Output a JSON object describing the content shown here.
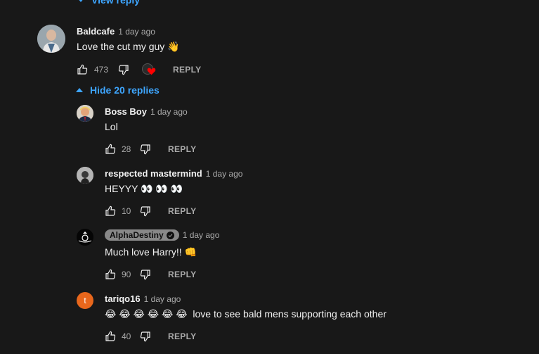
{
  "top_toggle": {
    "label": "View reply"
  },
  "main_comment": {
    "author": "Baldcafe",
    "time": "1 day ago",
    "text": "Love the cut my guy 👋",
    "likes": "473",
    "reply_label": "REPLY"
  },
  "replies_toggle": {
    "label": "Hide 20 replies"
  },
  "replies": [
    {
      "author": "Boss Boy",
      "time": "1 day ago",
      "text": "Lol",
      "likes": "28",
      "reply_label": "REPLY"
    },
    {
      "author": "respected mastermind",
      "time": "1 day ago",
      "text": "HEYYY 👀 👀 👀",
      "likes": "10",
      "reply_label": "REPLY"
    },
    {
      "author": "AlphaDestiny",
      "time": "1 day ago",
      "text": "Much love Harry!! 👊",
      "likes": "90",
      "reply_label": "REPLY"
    },
    {
      "author": "tariqo16",
      "avatar_letter": "t",
      "time": "1 day ago",
      "text": "😂 😂 😂 😂 😂 😂  love to see bald mens supporting each other",
      "likes": "40",
      "reply_label": "REPLY"
    }
  ],
  "colors": {
    "background": "#181818",
    "link": "#3ea6ff",
    "muted": "#aaaaaa",
    "heart": "#ff0000",
    "tariq_avatar": "#e8671c"
  }
}
